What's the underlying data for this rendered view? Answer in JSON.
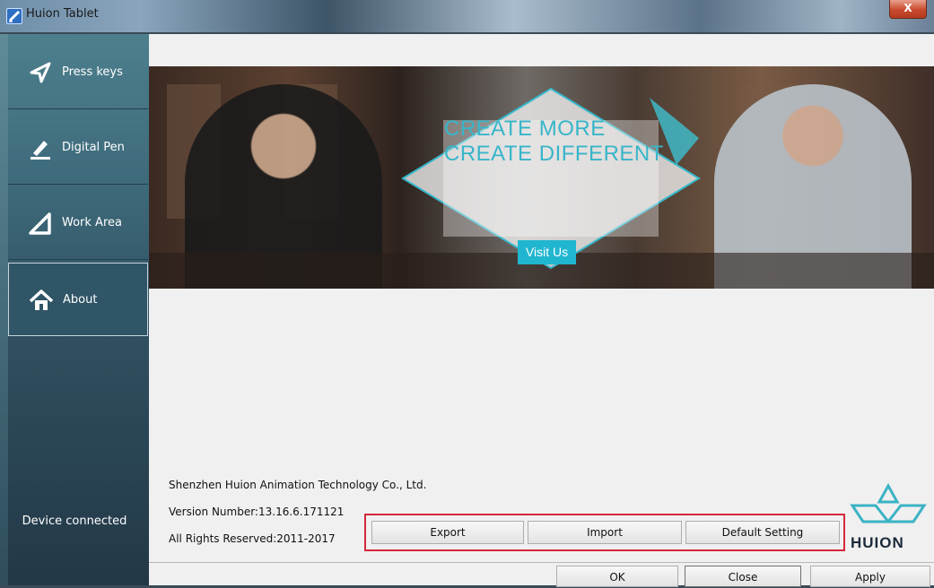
{
  "window": {
    "title": "Huion Tablet",
    "close_label": "X"
  },
  "sidebar": {
    "items": [
      {
        "label": "Press keys",
        "icon": "send-arrow-icon"
      },
      {
        "label": "Digital Pen",
        "icon": "pen-icon"
      },
      {
        "label": "Work Area",
        "icon": "triangle-icon"
      },
      {
        "label": "About",
        "icon": "home-icon"
      }
    ],
    "active": "About",
    "status": "Device connected"
  },
  "banner": {
    "headline_line1": "CREATE MORE",
    "headline_line2": "CREATE DIFFERENT",
    "visit_label": "Visit Us"
  },
  "about": {
    "company": "Shenzhen Huion Animation Technology Co., Ltd.",
    "version": "Version Number:13.16.6.171121",
    "rights": "All Rights Reserved:2011-2017"
  },
  "actions": {
    "export": "Export",
    "import": "Import",
    "default": "Default Setting"
  },
  "footer": {
    "ok": "OK",
    "close": "Close",
    "apply": "Apply"
  },
  "logo": {
    "brand": "HUION"
  },
  "colors": {
    "accent": "#20b6cf",
    "highlight_border": "#d5273a",
    "sidebar": "#3f6c7c"
  }
}
